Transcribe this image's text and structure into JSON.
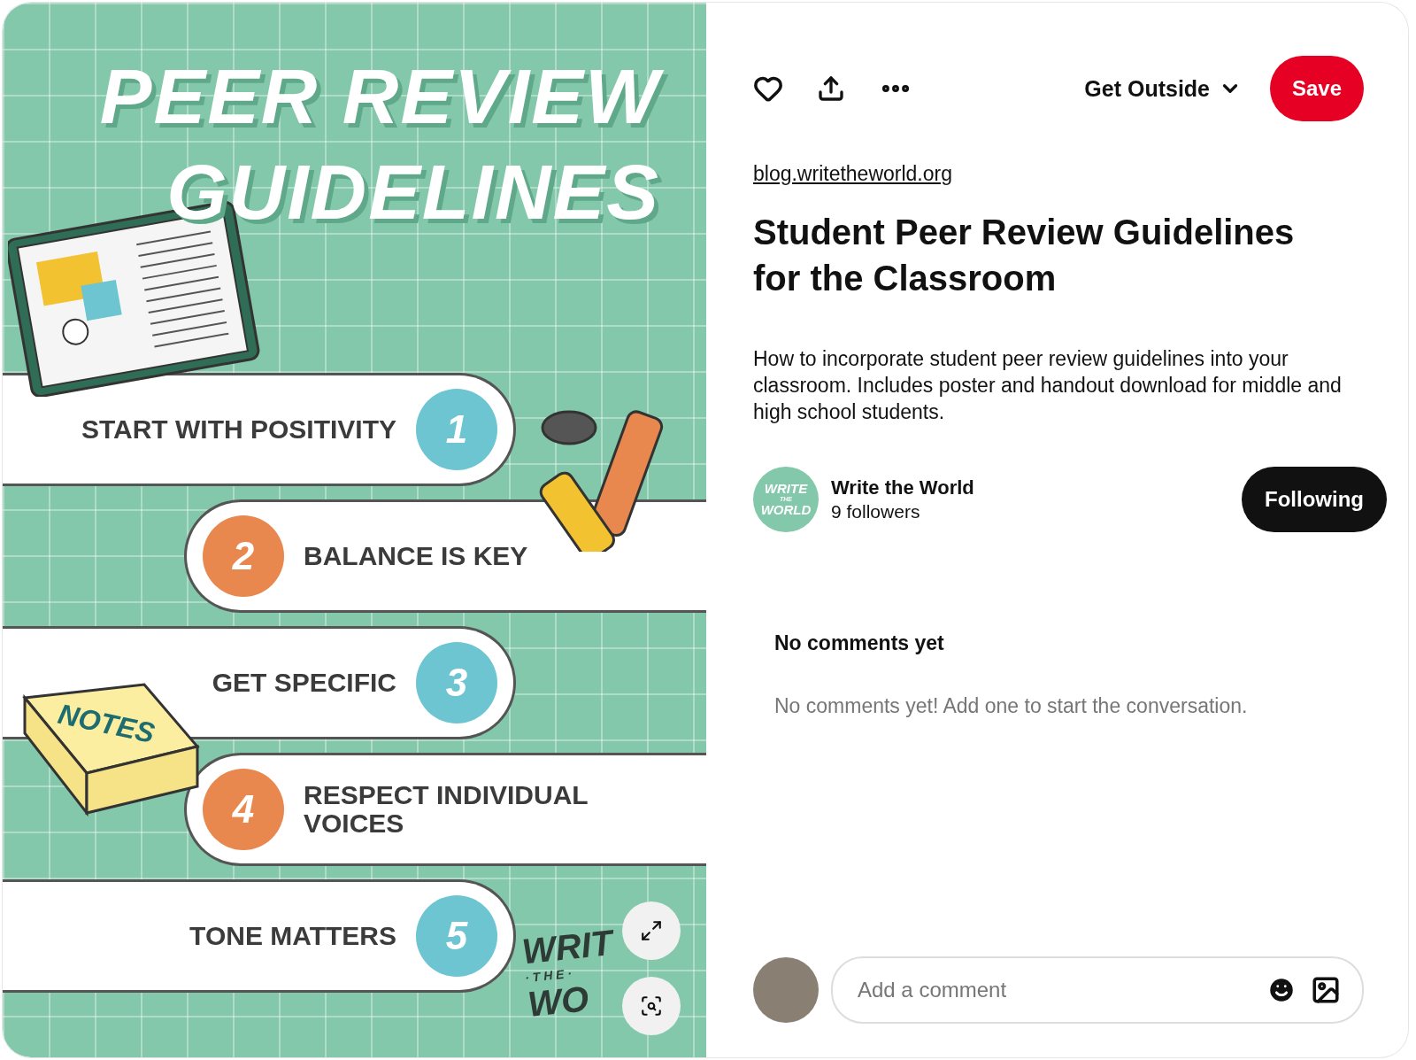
{
  "pin_image": {
    "title_lines": [
      "PEER REVIEW",
      "GUIDELINES"
    ],
    "steps": [
      {
        "number": "1",
        "label": "START WITH POSITIVITY",
        "kind": "left",
        "color": "#6cc5d1"
      },
      {
        "number": "2",
        "label": "BALANCE IS KEY",
        "kind": "right",
        "color": "#e8884f"
      },
      {
        "number": "3",
        "label": "GET SPECIFIC",
        "kind": "left",
        "color": "#6cc5d1"
      },
      {
        "number": "4",
        "label": "RESPECT INDIVIDUAL VOICES",
        "kind": "right",
        "color": "#e8884f"
      },
      {
        "number": "5",
        "label": "TONE MATTERS",
        "kind": "left",
        "color": "#6cc5d1"
      }
    ],
    "notes_label": "NOTES",
    "logo_lines": [
      "WRIT",
      "· T H E ·",
      "WO"
    ]
  },
  "toolbar": {
    "board": "Get Outside",
    "save": "Save"
  },
  "source_link": "blog.writetheworld.org",
  "title": "Student Peer Review Guidelines for the Classroom",
  "description": "How to incorporate student peer review guidelines into your classroom. Includes poster and handout download for middle and high school students.",
  "author": {
    "avatar_lines": [
      "WRITE",
      "THE",
      "WORLD"
    ],
    "name": "Write the World",
    "followers": "9 followers",
    "follow_button": "Following",
    "following": true
  },
  "comments": {
    "heading": "No comments yet",
    "empty_text": "No comments yet! Add one to start the conversation.",
    "input": {
      "placeholder": "Add a comment"
    }
  }
}
